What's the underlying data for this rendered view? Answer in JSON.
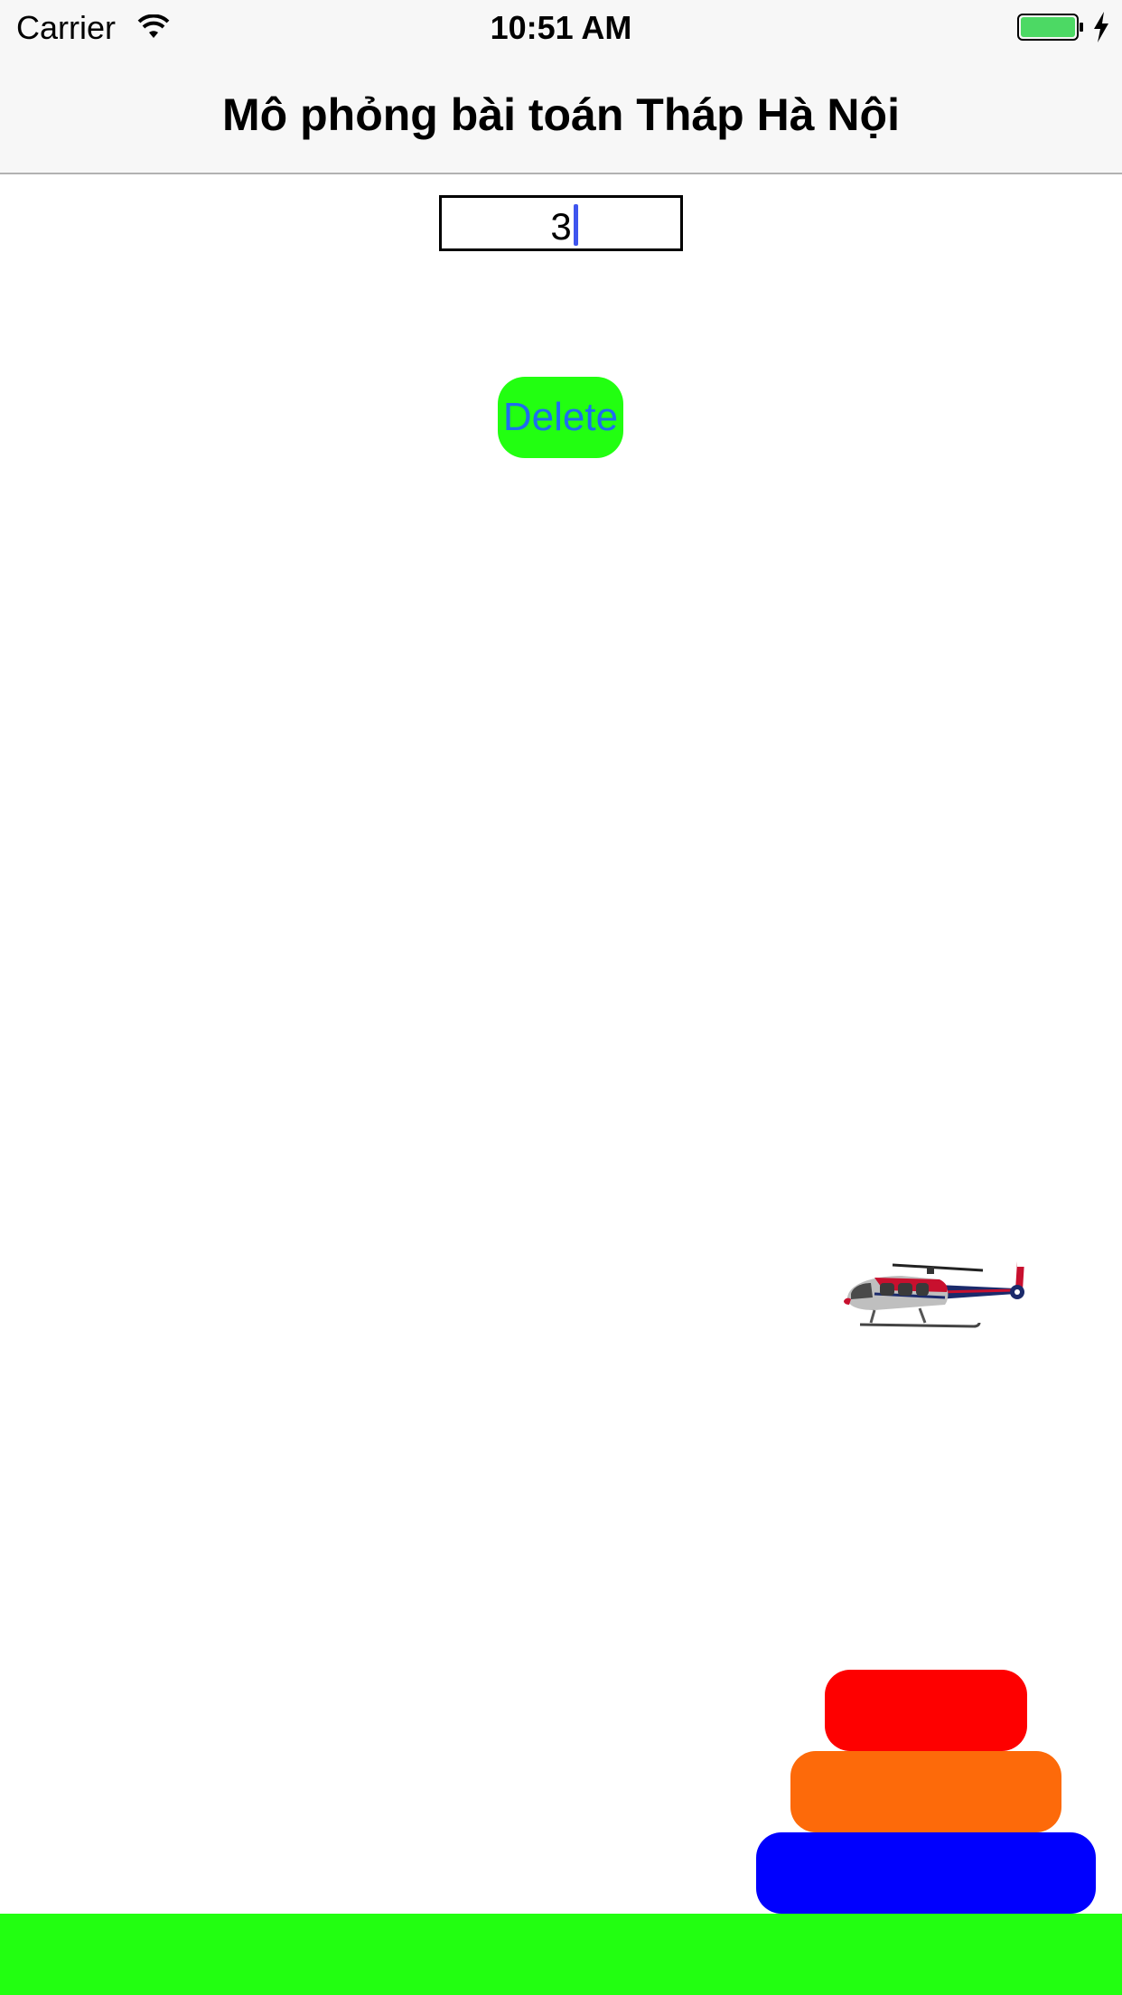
{
  "status_bar": {
    "carrier": "Carrier",
    "time": "10:51 AM",
    "icons": [
      "wifi-icon",
      "battery-icon",
      "charging-icon"
    ]
  },
  "nav_bar": {
    "title": "Mô phỏng bài toán Tháp Hà Nội"
  },
  "input": {
    "value": "3"
  },
  "buttons": {
    "delete_label": "Delete"
  },
  "scene": {
    "helicopter": "helicopter-image",
    "discs": [
      {
        "name": "small",
        "color": "#fe0000"
      },
      {
        "name": "medium",
        "color": "#fd6a0a"
      },
      {
        "name": "large",
        "color": "#0000fe"
      }
    ],
    "ground_color": "#22ff11"
  },
  "colors": {
    "button_bg": "#22ff11",
    "button_text": "#1e6cf0",
    "caret": "#3f55ee",
    "battery": "#4cd964"
  }
}
